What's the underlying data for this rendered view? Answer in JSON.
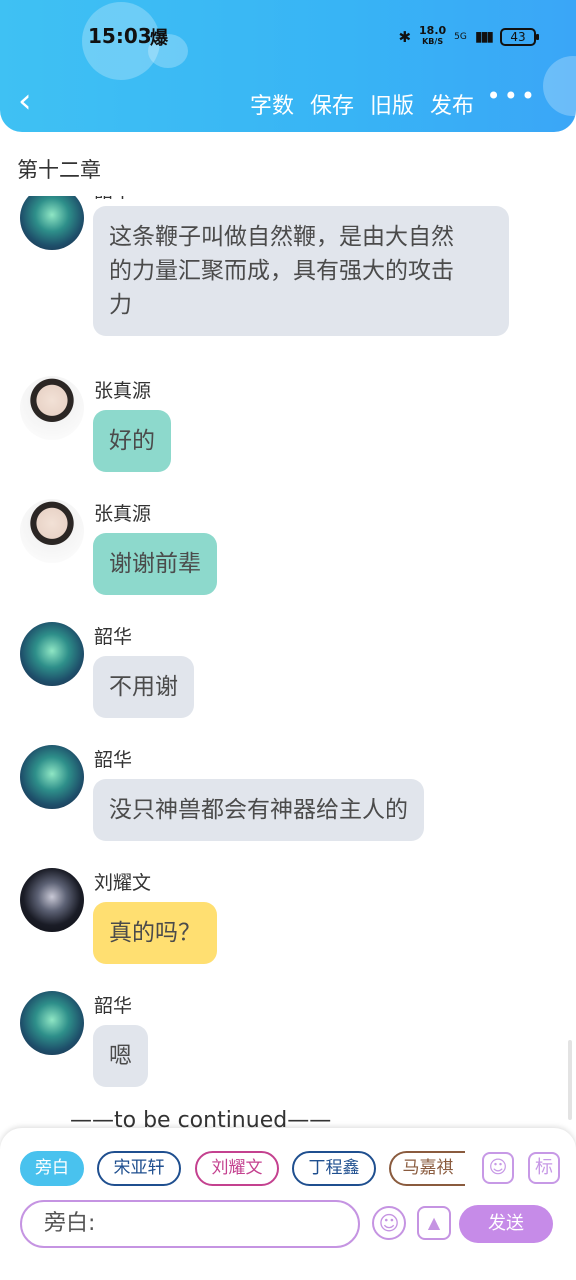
{
  "status_bar": {
    "time": "15:03",
    "net_speed": "18.0",
    "net_unit": "KB/S",
    "network": "5G",
    "battery": "43"
  },
  "nav": {
    "back_icon": "chevron-left-icon",
    "items": [
      "字数",
      "保存",
      "旧版",
      "发布"
    ],
    "more_icon": "more-dots-icon"
  },
  "chapter_title": "第十二章",
  "messages": [
    {
      "name": "韶华",
      "text_lines": [
        "这条鞭子叫做自然鞭，是由大自然",
        "的力量汇聚而成，具有强大的攻击",
        "力"
      ],
      "color": "#e1e5ec"
    },
    {
      "name": "张真源",
      "text_lines": [
        "好的"
      ],
      "color": "#8dd9cc"
    },
    {
      "name": "张真源",
      "text_lines": [
        "谢谢前辈"
      ],
      "color": "#8dd9cc"
    },
    {
      "name": "韶华",
      "text_lines": [
        "不用谢"
      ],
      "color": "#e1e5ec"
    },
    {
      "name": "韶华",
      "text_lines": [
        "没只神兽都会有神器给主人的"
      ],
      "color": "#e1e5ec"
    },
    {
      "name": "刘耀文",
      "text_lines": [
        "真的吗？"
      ],
      "color": "#ffdf71"
    },
    {
      "name": "韶华",
      "text_lines": [
        "嗯"
      ],
      "color": "#e1e5ec"
    }
  ],
  "footer_text": "——to be continued——",
  "roles": [
    {
      "label": "旁白",
      "color": "#49c2ee",
      "selected": true
    },
    {
      "label": "宋亚轩",
      "color": "#1f4f8f",
      "selected": false
    },
    {
      "label": "刘耀文",
      "color": "#c4418f",
      "selected": false
    },
    {
      "label": "丁程鑫",
      "color": "#1f4f8f",
      "selected": false
    },
    {
      "label": "马嘉祺",
      "color": "#8a5b3e",
      "selected": false
    }
  ],
  "role_icon": "person-icon",
  "tag_label": "标",
  "input": {
    "value": "旁白:"
  },
  "emoji_icon": "smile-icon",
  "image_icon": "image-icon",
  "send_label": "发送"
}
